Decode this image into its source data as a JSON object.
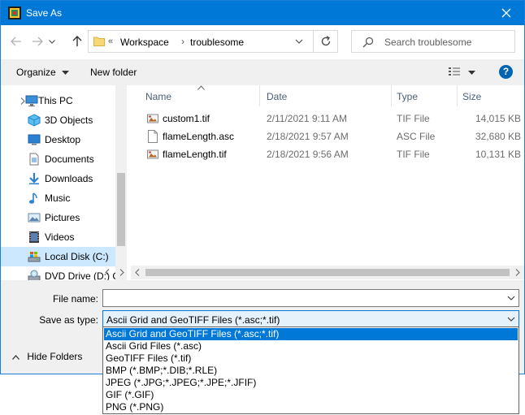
{
  "window": {
    "title": "Save As",
    "accent": "#0078d7"
  },
  "address": {
    "overflow": "«",
    "crumbs": [
      "Workspace",
      "troublesome"
    ],
    "search_placeholder": "Search troublesome"
  },
  "toolbar": {
    "organize": "Organize",
    "new_folder": "New folder",
    "help": "?"
  },
  "sidebar": {
    "items": [
      {
        "label": "This PC",
        "icon": "pc-icon"
      },
      {
        "label": "3D Objects",
        "icon": "3d-objects-icon"
      },
      {
        "label": "Desktop",
        "icon": "desktop-icon"
      },
      {
        "label": "Documents",
        "icon": "documents-icon"
      },
      {
        "label": "Downloads",
        "icon": "downloads-icon"
      },
      {
        "label": "Music",
        "icon": "music-icon"
      },
      {
        "label": "Pictures",
        "icon": "pictures-icon"
      },
      {
        "label": "Videos",
        "icon": "videos-icon"
      },
      {
        "label": "Local Disk (C:)",
        "icon": "disk-icon",
        "selected": true
      },
      {
        "label": "DVD Drive (D:) C",
        "icon": "dvd-icon"
      }
    ]
  },
  "files": {
    "columns": [
      "Name",
      "Date",
      "Type",
      "Size"
    ],
    "rows": [
      {
        "name": "custom1.tif",
        "date": "2/11/2021 9:11 AM",
        "type": "TIF File",
        "size": "14,015 KB",
        "icon": "image-file-icon"
      },
      {
        "name": "flameLength.asc",
        "date": "2/18/2021 9:57 AM",
        "type": "ASC File",
        "size": "32,680 KB",
        "icon": "text-file-icon"
      },
      {
        "name": "flameLength.tif",
        "date": "2/18/2021 9:56 AM",
        "type": "TIF File",
        "size": "10,131 KB",
        "icon": "image-file-icon"
      }
    ]
  },
  "form": {
    "file_name_label": "File name:",
    "file_name_value": "",
    "save_type_label": "Save as type:",
    "save_type_value": "Ascii Grid and GeoTIFF Files (*.asc;*.tif)",
    "hide_folders": "Hide Folders"
  },
  "dropdown": {
    "options": [
      "Ascii Grid and GeoTIFF Files (*.asc;*.tif)",
      "Ascii Grid Files (*.asc)",
      "GeoTIFF Files (*.tif)",
      "BMP (*.BMP;*.DIB;*.RLE)",
      "JPEG (*.JPG;*.JPEG;*.JPE;*.JFIF)",
      "GIF (*.GIF)",
      "PNG (*.PNG)"
    ],
    "selected_index": 0
  }
}
